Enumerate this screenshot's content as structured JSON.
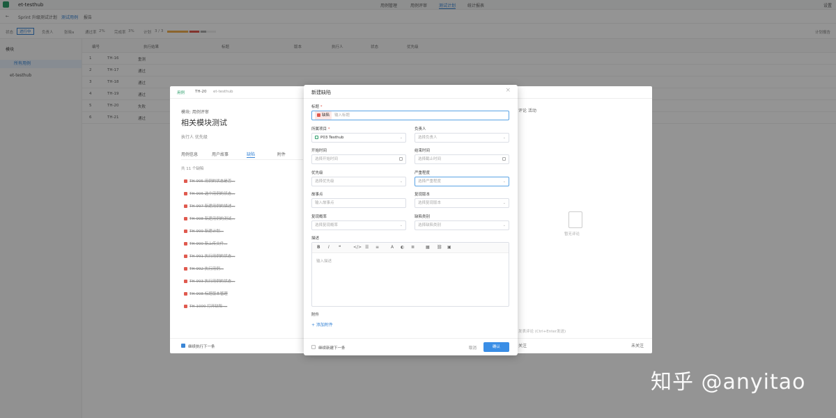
{
  "app": {
    "project_switch": "et-testhub",
    "nav": [
      "用例管理",
      "用例评审",
      "测试计划",
      "统计报表"
    ],
    "active_nav": "测试计划",
    "right_link": "设置"
  },
  "subbar": {
    "back": "←",
    "sprint": "Sprint 升级测试计划",
    "tabs": [
      "测试用例",
      "报告"
    ]
  },
  "infobar": {
    "status_label": "状态",
    "status_badge": "进行中",
    "owner_label": "负责人",
    "owner": "张晓a",
    "pass_label": "通过率",
    "pass_val": "2%",
    "done_label": "完成率",
    "done_val": "3%",
    "exec_label": "计划",
    "exec_val": "3 / 3",
    "right": "计划报告"
  },
  "sidebar": {
    "header": "模块",
    "items": [
      "所有用例",
      "et-testhub"
    ]
  },
  "table": {
    "headers": [
      "编号",
      "执行结果",
      "标题",
      "版本",
      "执行人",
      "状态",
      "优先级"
    ],
    "rows": [
      {
        "num": "1",
        "id": "TH-16",
        "res": "重测"
      },
      {
        "num": "2",
        "id": "TH-17",
        "res": "通过"
      },
      {
        "num": "3",
        "id": "TH-18",
        "res": "通过"
      },
      {
        "num": "4",
        "id": "TH-19",
        "res": "通过"
      },
      {
        "num": "5",
        "id": "TH-20",
        "res": "失败"
      },
      {
        "num": "6",
        "id": "TH-21",
        "res": "通过"
      }
    ]
  },
  "detail": {
    "tag": "用例",
    "code": "TH-20",
    "project": "et-testhub",
    "module": "模块: 用例评审",
    "title": "相关模块测试",
    "fields": "执行人                                                       优先级",
    "tabs": [
      "用例信息",
      "用户故事",
      "缺陷",
      "附件"
    ],
    "bug_count": "共 11 个缺陷",
    "bugs": [
      "TH-995  用例的状态是否...",
      "TH-996  选中用例的状态...",
      "TH-997  新建用例的描述...",
      "TH-998  新建用例的测试...",
      "TH-999  新建计划...",
      "TH-990  新上传文件...",
      "TH-991  执行用例的状态...",
      "TH-992  执行用例...",
      "TH-993  执行用例的状态...",
      "TH-998  标题版本管理",
      "TH-1000 打开缺陷 ..."
    ],
    "continue_label": "继续执行下一条",
    "right_tabs": "评论    活动",
    "empty_text": "暂无评论",
    "comment_ph": "发表评论 (Ctrl+Enter发送)",
    "follow": "关注",
    "unfollow": "未关注"
  },
  "modal": {
    "title": "新建缺陷",
    "close": "×",
    "title_label": "标题",
    "type_tag": "缺陷",
    "title_ph": "输入标题",
    "project_label": "所属项目",
    "project_val": "P03 Testhub",
    "assignee_label": "负责人",
    "assignee_ph": "选择负责人",
    "start_label": "开始时间",
    "start_ph": "选择开始时间",
    "end_label": "结束时间",
    "end_ph": "选择截止时间",
    "priority_label": "优先级",
    "priority_ph": "选择优先级",
    "severity_label": "严重程度",
    "severity_ph": "选择严重程度",
    "story_label": "故事点",
    "story_ph": "输入故事点",
    "version_label": "复现版本",
    "version_ph": "选择复现版本",
    "prob_label": "复现概率",
    "prob_ph": "选择复现概率",
    "category_label": "缺陷类别",
    "category_ph": "选择缺陷类别",
    "desc_label": "描述",
    "desc_ph": "输入描述",
    "toolbar": [
      "B",
      "I",
      "❝",
      "</>",
      "☰",
      "≡",
      "A",
      "◐",
      "≣",
      "▦",
      "⛓",
      "▣"
    ],
    "attach_label": "附件",
    "add_attach": "+ 添加附件",
    "continue_label": "继续新建下一条",
    "cancel": "取消",
    "confirm": "确认"
  },
  "watermark": "知乎 @anyitao",
  "colors": {
    "accent": "#3a8ee6",
    "bug": "#e05a4f",
    "project": "#2e9e6c"
  }
}
